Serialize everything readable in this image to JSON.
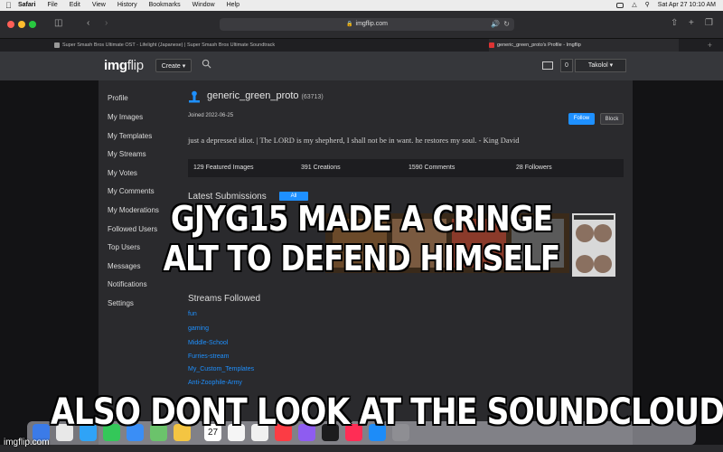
{
  "menubar": {
    "items": [
      "Safari",
      "File",
      "Edit",
      "View",
      "History",
      "Bookmarks",
      "Window",
      "Help"
    ],
    "datetime": "Sat Apr 27  10:10 AM"
  },
  "browser": {
    "url": "imgflip.com",
    "tabs": [
      "Super Smash Bros Ultimate OST - Lifelight (Japanese) | Super Smash Bros Ultimate Soundtrack",
      "generic_green_proto's Profile - Imgflip"
    ]
  },
  "site": {
    "logo_img": "img",
    "logo_flip": "flip",
    "create_label": "Create ▾",
    "notif_count": "0",
    "user_label": "Takolol ▾"
  },
  "sidebar": {
    "items": [
      "Profile",
      "My Images",
      "My Templates",
      "My Streams",
      "My Votes",
      "My Comments",
      "My Moderations",
      "Followed Users",
      "Top Users",
      "Messages",
      "Notifications",
      "Settings"
    ]
  },
  "profile": {
    "username": "generic_green_proto",
    "points": "(63713)",
    "joined": "Joined 2022-06-25",
    "follow_label": "Follow",
    "block_label": "Block",
    "bio": "just a depressed idiot. | The LORD is my shepherd, I shall not be in want. he restores my soul. - King David",
    "stats": [
      "129 Featured Images",
      "391 Creations",
      "1590 Comments",
      "28 Followers"
    ],
    "submissions_label": "Latest Submissions",
    "submissions_badge": "All",
    "streams_title": "Streams Followed",
    "streams": [
      "fun",
      "gaming",
      "Middle-School",
      "Furries-stream",
      "My_Custom_Templates",
      "Anti-Zoophile-Army"
    ]
  },
  "dock": {
    "date": "27"
  },
  "meme": {
    "top_line1": "GJYG15 MADE A CRINGE",
    "top_line2": "ALT TO DEFEND HIMSELF",
    "bottom": "ALSO DONT LOOK AT THE SOUNDCLOUD",
    "watermark": "imgflip.com"
  },
  "colors": {
    "accent": "#1e90ff",
    "panel": "#2a2a2d",
    "header": "#36373b"
  },
  "icons": [
    "apple-icon",
    "search-icon",
    "mail-icon",
    "user-icon",
    "lock-icon",
    "reload-icon",
    "share-icon",
    "new-tab-icon",
    "tabs-overview-icon"
  ]
}
